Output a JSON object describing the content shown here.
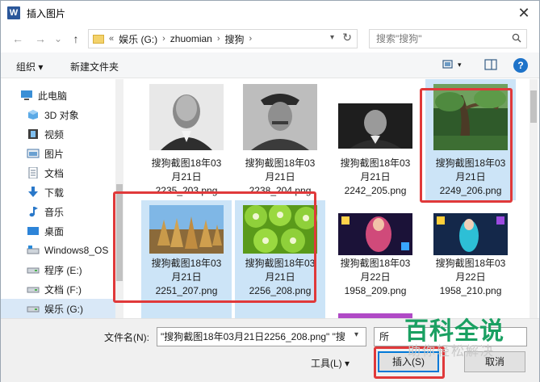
{
  "window": {
    "title": "插入图片",
    "app_icon_letter": "W",
    "close_glyph": "✕"
  },
  "nav": {
    "back": "←",
    "forward": "→",
    "dropdown": "⌄",
    "up": "↑",
    "crumb_prefix": "«",
    "breadcrumbs": [
      "娱乐 (G:)",
      "zhuomian",
      "搜狗"
    ],
    "refresh": "↻",
    "search_placeholder": "搜索\"搜狗\""
  },
  "toolbar": {
    "organize": "组织 ▾",
    "new_folder": "新建文件夹",
    "help": "?"
  },
  "sidebar": {
    "items": [
      {
        "label": "此电脑",
        "icon": "computer-icon"
      },
      {
        "label": "3D 对象",
        "icon": "cube-icon"
      },
      {
        "label": "视频",
        "icon": "video-icon"
      },
      {
        "label": "图片",
        "icon": "picture-icon"
      },
      {
        "label": "文档",
        "icon": "document-icon"
      },
      {
        "label": "下载",
        "icon": "download-icon"
      },
      {
        "label": "音乐",
        "icon": "music-icon"
      },
      {
        "label": "桌面",
        "icon": "desktop-icon"
      },
      {
        "label": "Windows8_OS",
        "icon": "drive-icon"
      },
      {
        "label": "程序 (E:)",
        "icon": "drive-icon"
      },
      {
        "label": "文档 (F:)",
        "icon": "drive-icon"
      },
      {
        "label": "娱乐 (G:)",
        "icon": "drive-icon"
      }
    ]
  },
  "files": [
    {
      "line1": "搜狗截图18年03",
      "line2": "月21日",
      "line3": "2235_203.png",
      "selected": false
    },
    {
      "line1": "搜狗截图18年03",
      "line2": "月21日",
      "line3": "2238_204.png",
      "selected": false
    },
    {
      "line1": "搜狗截图18年03",
      "line2": "月21日",
      "line3": "2242_205.png",
      "selected": false
    },
    {
      "line1": "搜狗截图18年03",
      "line2": "月21日",
      "line3": "2249_206.png",
      "selected": true
    },
    {
      "line1": "搜狗截图18年03",
      "line2": "月21日",
      "line3": "2251_207.png",
      "selected": true
    },
    {
      "line1": "搜狗截图18年03",
      "line2": "月21日",
      "line3": "2256_208.png",
      "selected": true
    },
    {
      "line1": "搜狗截图18年03",
      "line2": "月22日",
      "line3": "1958_209.png",
      "selected": false
    },
    {
      "line1": "搜狗截图18年03",
      "line2": "月22日",
      "line3": "1958_210.png",
      "selected": false
    }
  ],
  "bottom": {
    "filename_label": "文件名(N):",
    "filename_value": "\"搜狗截图18年03月21日2256_208.png\" \"搜",
    "filter_value": "所",
    "tools": "工具(L)  ▾",
    "insert": "插入(S)",
    "cancel": "取消"
  },
  "watermark": {
    "title": "百科全说",
    "subtitle": "助你轻松解决"
  }
}
